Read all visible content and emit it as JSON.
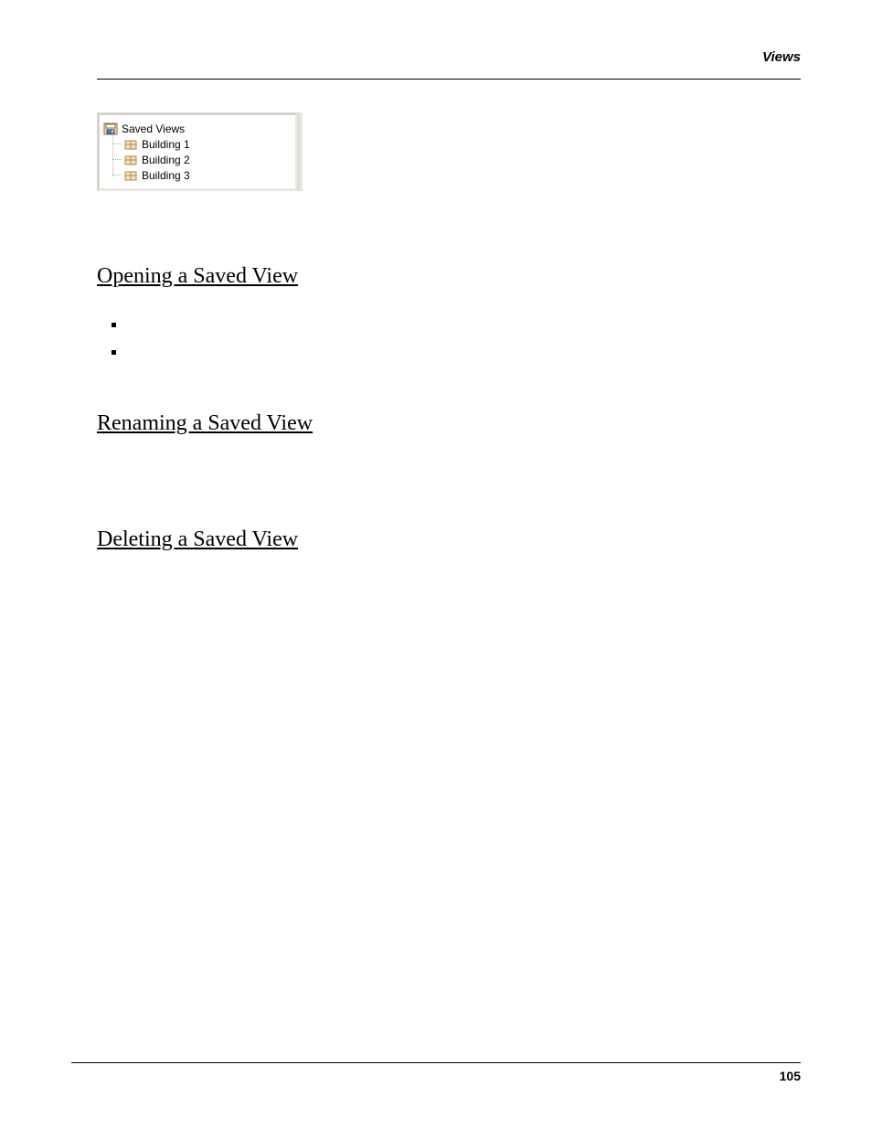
{
  "header": {
    "section": "Views"
  },
  "tree": {
    "root": "Saved Views",
    "items": [
      "Building 1",
      "Building 2",
      "Building 3"
    ]
  },
  "sections": {
    "open": {
      "title": "Opening a Saved View"
    },
    "rename": {
      "title": "Renaming a Saved View"
    },
    "delete": {
      "title": "Deleting a Saved View"
    }
  },
  "footer": {
    "page": "105"
  }
}
